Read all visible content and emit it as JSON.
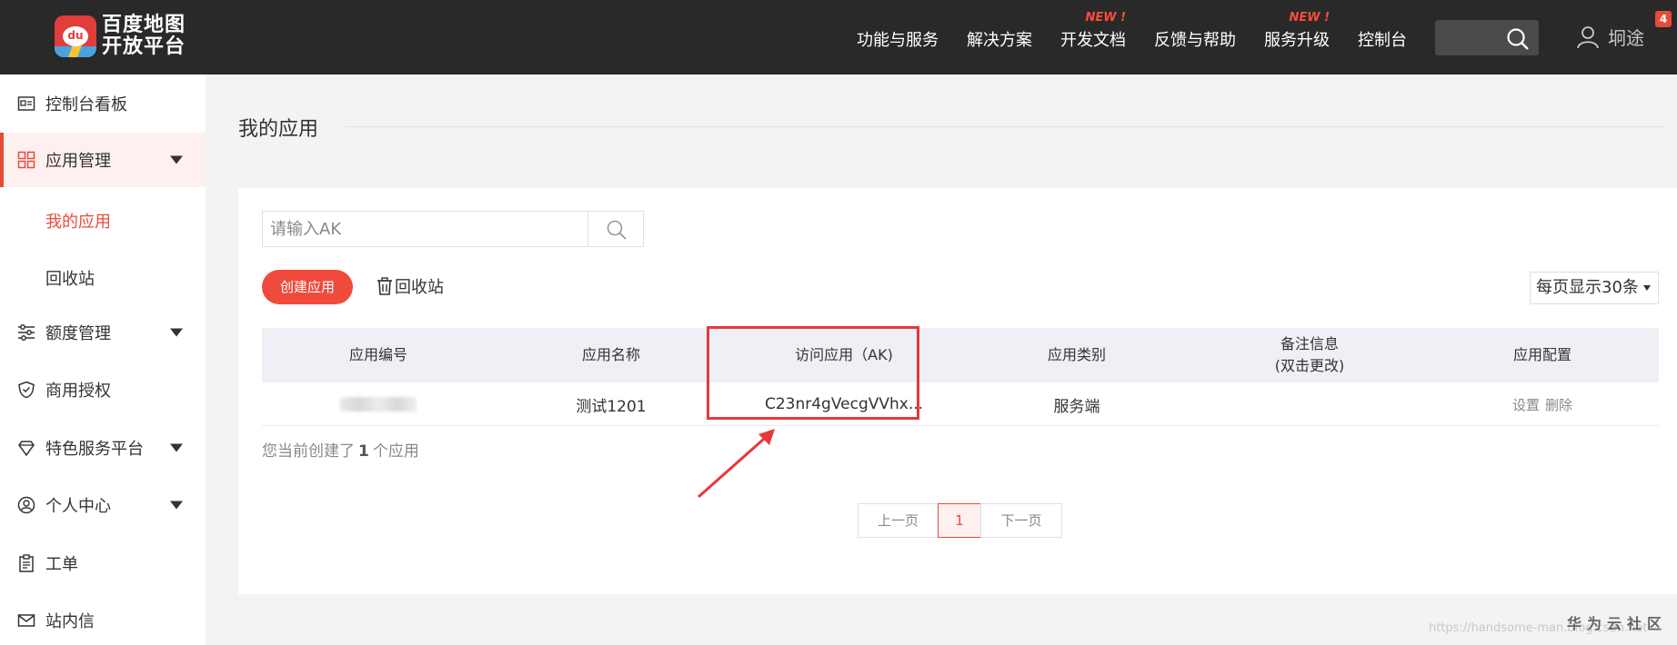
{
  "header": {
    "logo_line1": "百度地图",
    "logo_line2": "开放平台",
    "logo_badge": "du",
    "nav": [
      {
        "label": "功能与服务",
        "new": ""
      },
      {
        "label": "解决方案",
        "new": ""
      },
      {
        "label": "开发文档",
        "new": "NEW !"
      },
      {
        "label": "反馈与帮助",
        "new": ""
      },
      {
        "label": "服务升级",
        "new": "NEW !"
      },
      {
        "label": "控制台",
        "new": ""
      }
    ],
    "user_name": "坰途",
    "notification_count": "4",
    "search_icon": "search-icon",
    "user_icon": "user-icon"
  },
  "sidebar": {
    "items": [
      {
        "label": "控制台看板",
        "icon": "dashboard-icon"
      },
      {
        "label": "应用管理",
        "icon": "grid-icon"
      },
      {
        "label": "额度管理",
        "icon": "sliders-icon"
      },
      {
        "label": "商用授权",
        "icon": "shield-icon"
      },
      {
        "label": "特色服务平台",
        "icon": "gem-icon"
      },
      {
        "label": "个人中心",
        "icon": "user-circle-icon"
      },
      {
        "label": "工单",
        "icon": "clipboard-icon"
      },
      {
        "label": "站内信",
        "icon": "mail-icon"
      }
    ],
    "sub_items": [
      {
        "label": "我的应用"
      },
      {
        "label": "回收站"
      }
    ]
  },
  "main": {
    "page_title": "我的应用",
    "search_placeholder": "请输入AK",
    "create_button": "创建应用",
    "recycle_link": "回收站",
    "per_page": "每页显示30条",
    "table": {
      "columns": [
        "应用编号",
        "应用名称",
        "访问应用（AK)",
        "应用类别",
        "备注信息",
        "(双击更改)",
        "应用配置"
      ],
      "rows": [
        {
          "id": "",
          "name": "测试1201",
          "ak": "C23nr4gVecgVVhx...",
          "type": "服务端",
          "note": "",
          "action_settings": "设置",
          "action_delete": "删除"
        }
      ]
    },
    "count_prefix": "您当前创建了",
    "count_value": "1",
    "count_suffix": "个应用",
    "pager": {
      "prev": "上一页",
      "current": "1",
      "next": "下一页"
    }
  },
  "watermark": "https://handsome-man.blog.csdn.net",
  "watermark_brand": "华为云社区",
  "colors": {
    "accent": "#ef4a3b",
    "header_bg": "#292929",
    "highlight": "#e8373a"
  }
}
